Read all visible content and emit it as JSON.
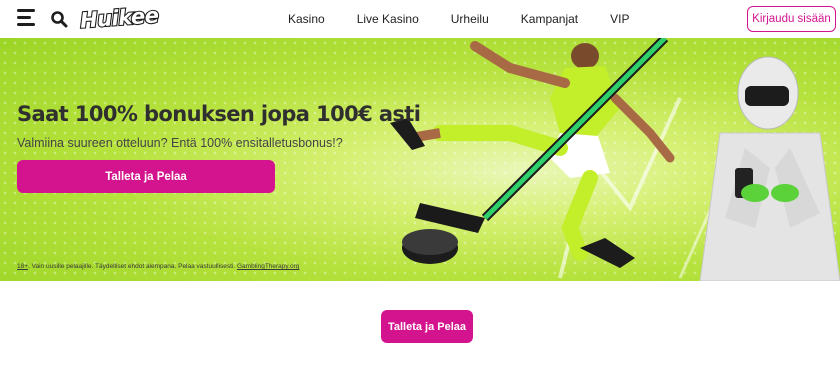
{
  "header": {
    "logo_text": "Huikee",
    "nav": [
      "Kasino",
      "Live Kasino",
      "Urheilu",
      "Kampanjat",
      "VIP"
    ],
    "login_label": "Kirjaudu sisään"
  },
  "hero": {
    "title": "Saat 100% bonuksen jopa 100€ asti",
    "subtitle": "Valmiina suureen otteluun? Entä 100% ensitalletusbonus!?",
    "cta_label": "Talleta ja Pelaa",
    "disclaimer": {
      "age": "18+",
      "text": ". Vain uusille pelaajille. Täydelliset ehdot alempana. Pelaa vastuullisesti. ",
      "link": "GamblingTherapy.org"
    }
  },
  "bottom": {
    "cta_label": "Talleta ja Pelaa"
  },
  "colors": {
    "accent": "#d4148f",
    "hero_green": "#b6e23d",
    "text_dark": "#2f2f2f"
  },
  "icons": [
    "menu-icon",
    "search-icon"
  ]
}
